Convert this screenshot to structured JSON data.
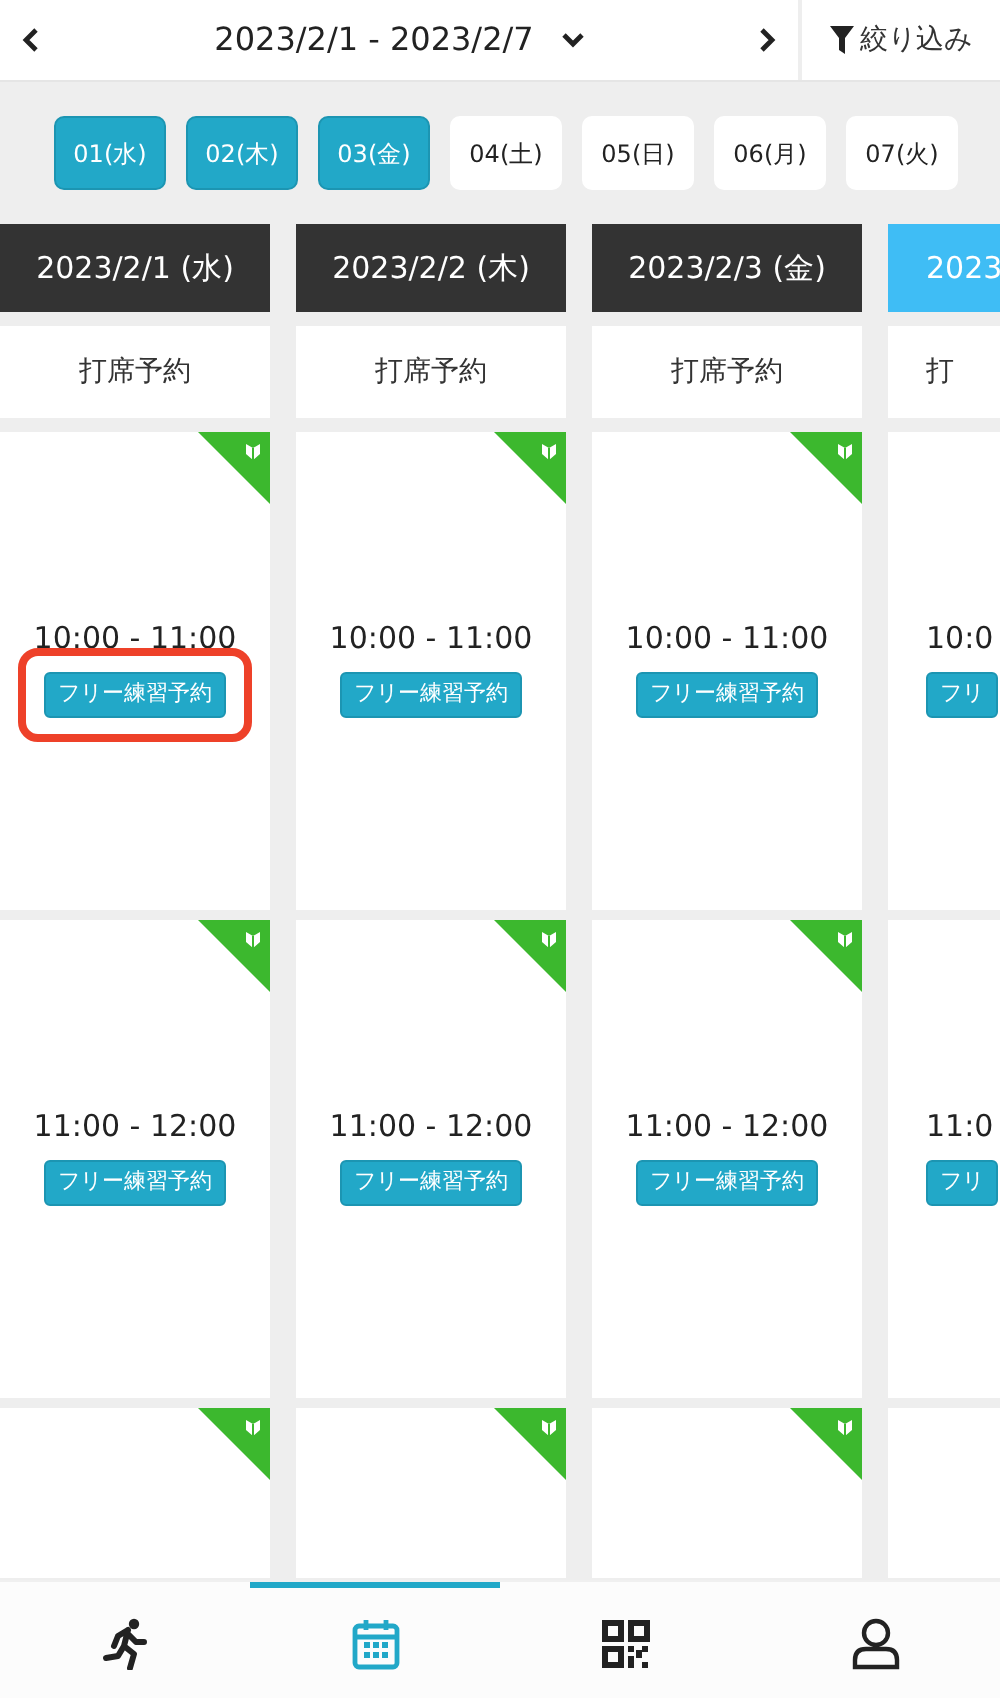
{
  "top_bar": {
    "range": "2023/2/1 - 2023/2/7",
    "filter_label": "絞り込み"
  },
  "day_chips": [
    {
      "label": "01(水)",
      "selected": true
    },
    {
      "label": "02(木)",
      "selected": true
    },
    {
      "label": "03(金)",
      "selected": true
    },
    {
      "label": "04(土)",
      "selected": false
    },
    {
      "label": "05(日)",
      "selected": false
    },
    {
      "label": "06(月)",
      "selected": false
    },
    {
      "label": "07(火)",
      "selected": false
    }
  ],
  "columns": [
    {
      "kind": "full",
      "date": "2023/2/1 (水)",
      "today": false,
      "category": "打席予約",
      "slots": [
        {
          "time": "10:00 - 11:00",
          "button": "フリー練習予約",
          "highlighted": true
        },
        {
          "time": "11:00 - 12:00",
          "button": "フリー練習予約",
          "highlighted": false
        },
        {
          "beginner": true
        }
      ]
    },
    {
      "kind": "full",
      "date": "2023/2/2 (木)",
      "today": false,
      "category": "打席予約",
      "slots": [
        {
          "time": "10:00 - 11:00",
          "button": "フリー練習予約",
          "highlighted": false
        },
        {
          "time": "11:00 - 12:00",
          "button": "フリー練習予約",
          "highlighted": false
        },
        {
          "beginner": true
        }
      ]
    },
    {
      "kind": "full",
      "date": "2023/2/3 (金)",
      "today": false,
      "category": "打席予約",
      "slots": [
        {
          "time": "10:00 - 11:00",
          "button": "フリー練習予約",
          "highlighted": false
        },
        {
          "time": "11:00 - 12:00",
          "button": "フリー練習予約",
          "highlighted": false
        },
        {
          "beginner": true
        }
      ]
    },
    {
      "kind": "partial",
      "date": "2023",
      "today": true,
      "category": "打",
      "slots": [
        {
          "time": "10:0",
          "button": "フリ",
          "highlighted": false
        },
        {
          "time": "11:0",
          "button": "フリ",
          "highlighted": false
        },
        {
          "beginner": false
        }
      ]
    }
  ],
  "bottom_nav": [
    {
      "kind": "runner",
      "selected": false
    },
    {
      "kind": "calendar",
      "selected": true
    },
    {
      "kind": "qr",
      "selected": false
    },
    {
      "kind": "person",
      "selected": false
    }
  ]
}
